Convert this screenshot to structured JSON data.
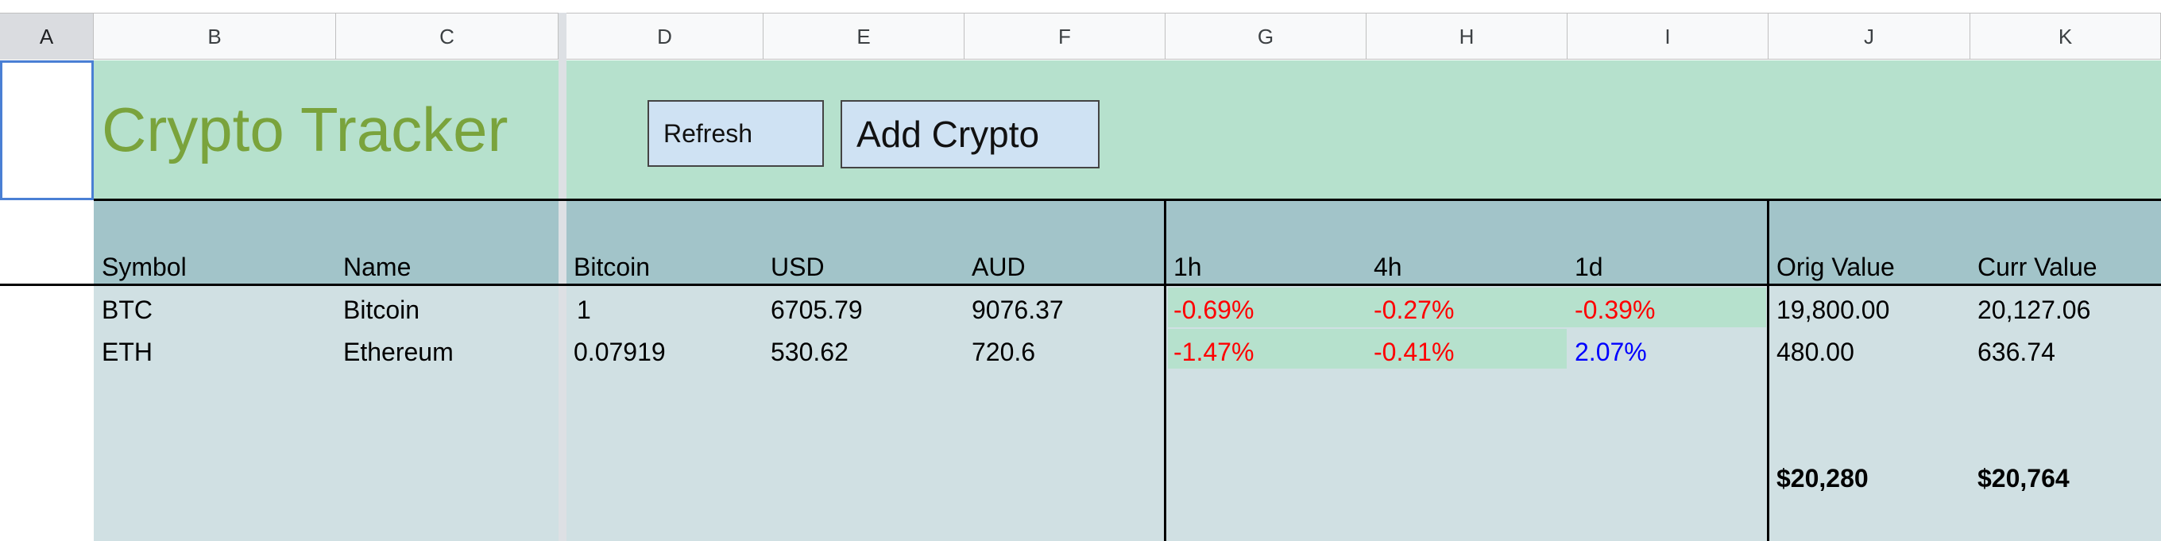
{
  "columns": [
    "A",
    "B",
    "C",
    "D",
    "E",
    "F",
    "G",
    "H",
    "I",
    "J",
    "K"
  ],
  "title": "Crypto Tracker",
  "buttons": {
    "refresh": "Refresh",
    "add": "Add Crypto"
  },
  "headers": {
    "symbol": "Symbol",
    "name": "Name",
    "bitcoin": "Bitcoin",
    "usd": "USD",
    "aud": "AUD",
    "h1": "1h",
    "h4": "4h",
    "d1": "1d",
    "orig_value": "Orig Value",
    "curr_value": "Curr Value"
  },
  "rows": [
    {
      "symbol": "BTC",
      "name": "Bitcoin",
      "bitcoin": "1",
      "usd": "6705.79",
      "aud": "9076.37",
      "h1": "-0.69%",
      "h4": "-0.27%",
      "d1": "-0.39%",
      "orig_value": "19,800.00",
      "curr_value": "20,127.06"
    },
    {
      "symbol": "ETH",
      "name": "Ethereum",
      "bitcoin": "0.07919",
      "usd": "530.62",
      "aud": "720.6",
      "h1": "-1.47%",
      "h4": "-0.41%",
      "d1": "2.07%",
      "orig_value": "480.00",
      "curr_value": "636.74"
    }
  ],
  "totals": {
    "orig_value": "$20,280",
    "curr_value": "$20,764"
  },
  "colors": {
    "title_band": "#b6e1cd",
    "header_band": "#a2c4c9",
    "body_band": "#d0e0e3",
    "title_text": "#7aa33c",
    "negative": "#ff0000",
    "positive": "#0000ff",
    "button": "#cfe2f3"
  }
}
